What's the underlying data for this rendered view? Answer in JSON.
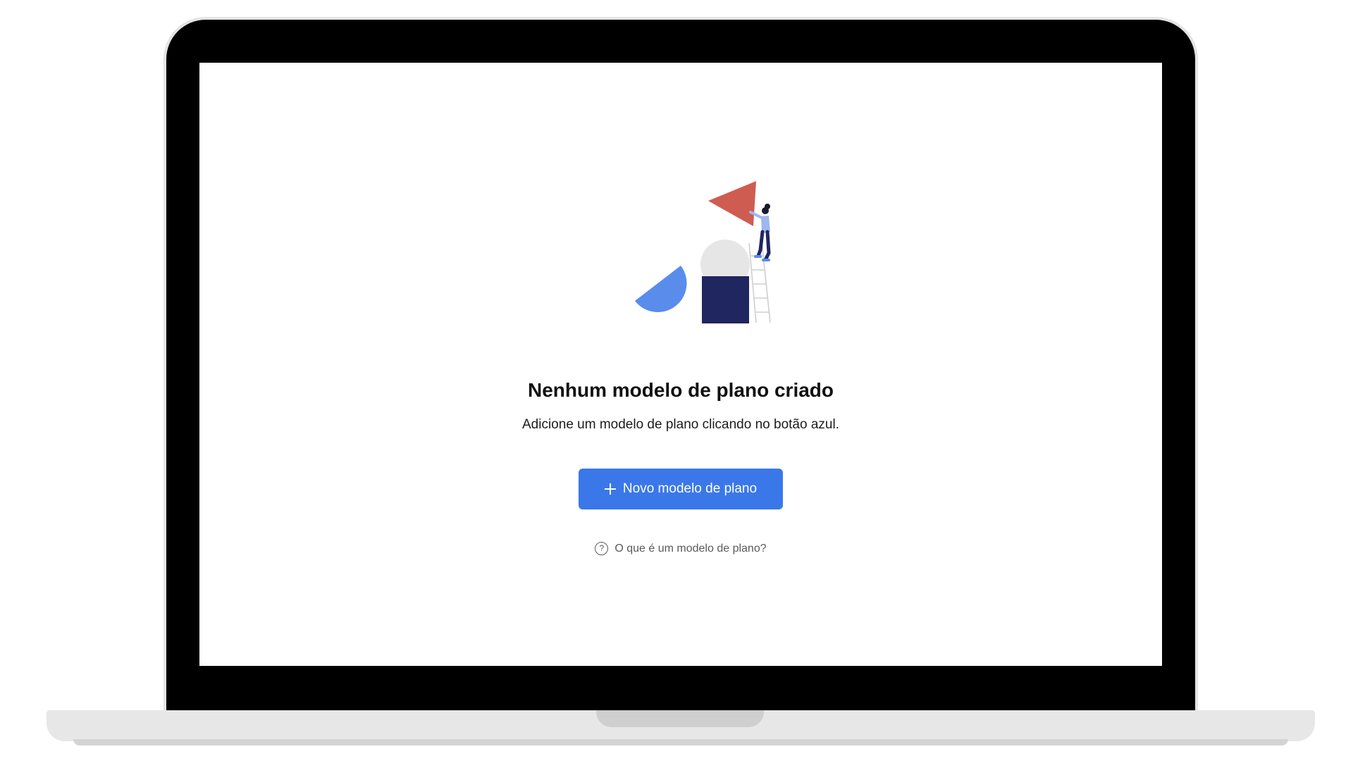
{
  "empty_state": {
    "title": "Nenhum modelo de plano criado",
    "subtitle": "Adicione um modelo de plano clicando no botão azul.",
    "primary_button": {
      "label": "Novo modelo de plano",
      "icon": "plus-icon"
    },
    "help_link": {
      "label": "O que é um modelo de plano?",
      "icon": "question-circle-icon",
      "icon_glyph": "?"
    },
    "illustration": {
      "name": "building-blocks-illustration"
    }
  },
  "colors": {
    "accent": "#3a78ea",
    "title_text": "#111111",
    "body_text": "#1c1c1c",
    "muted_text": "#5a5a5a",
    "triangle": "#cf5c50",
    "half_circle": "#5a8cec",
    "square": "#1f2660",
    "circle": "#e6e6e6",
    "bezel": "#000000",
    "chassis": "#e7e7e7"
  }
}
